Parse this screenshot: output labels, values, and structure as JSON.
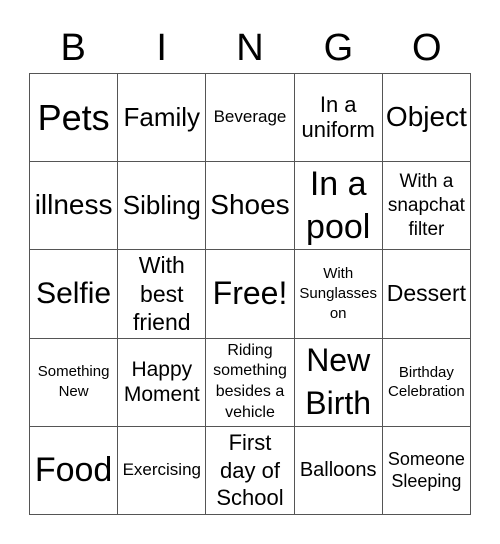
{
  "header": [
    "B",
    "I",
    "N",
    "G",
    "O"
  ],
  "cells": [
    "Pets",
    "Family",
    "Beverage",
    "In a\nuniform",
    "Object",
    "illness",
    "Sibling",
    "Shoes",
    "In a\npool",
    "With a\nsnapchat\nfilter",
    "Selfie",
    "With\nbest\nfriend",
    "Free!",
    "With\nSunglasses\non",
    "Dessert",
    "Something\nNew",
    "Happy\nMoment",
    "Riding\nsomething\nbesides a\nvehicle",
    "New\nBirth",
    "Birthday\nCelebration",
    "Food",
    "Exercising",
    "First\nday of\nSchool",
    "Balloons",
    "Someone\nSleeping"
  ]
}
